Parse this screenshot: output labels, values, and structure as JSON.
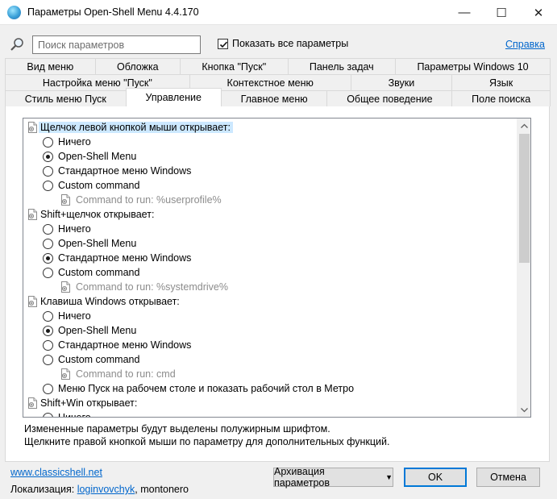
{
  "window": {
    "title": "Параметры Open-Shell Menu 4.4.170",
    "minimize_glyph": "—",
    "maximize_glyph": "☐",
    "close_glyph": "✕"
  },
  "toolbar": {
    "search_placeholder": "Поиск параметров",
    "show_all_label": "Показать все параметры",
    "show_all_checked": true,
    "help_label": "Справка"
  },
  "tabs": {
    "row1": [
      "Вид меню",
      "Обложка",
      "Кнопка \"Пуск\"",
      "Панель задач",
      "Параметры Windows 10"
    ],
    "row2": [
      "Настройка меню \"Пуск\"",
      "Контекстное меню",
      "Звуки",
      "Язык"
    ],
    "row3": [
      "Стиль меню Пуск",
      "Управление",
      "Главное меню",
      "Общее поведение",
      "Поле поиска"
    ],
    "active": "Управление"
  },
  "tree": {
    "groups": [
      {
        "label": "Щелчок левой кнопкой мыши открывает:",
        "selected": true,
        "options": [
          {
            "label": "Ничего",
            "checked": false
          },
          {
            "label": "Open-Shell Menu",
            "checked": true
          },
          {
            "label": "Стандартное меню Windows",
            "checked": false
          },
          {
            "label": "Custom command",
            "checked": false
          }
        ],
        "command": "Command to run: %userprofile%"
      },
      {
        "label": "Shift+щелчок открывает:",
        "selected": false,
        "options": [
          {
            "label": "Ничего",
            "checked": false
          },
          {
            "label": "Open-Shell Menu",
            "checked": false
          },
          {
            "label": "Стандартное меню Windows",
            "checked": true
          },
          {
            "label": "Custom command",
            "checked": false
          }
        ],
        "command": "Command to run: %systemdrive%"
      },
      {
        "label": "Клавиша Windows открывает:",
        "selected": false,
        "options": [
          {
            "label": "Ничего",
            "checked": false
          },
          {
            "label": "Open-Shell Menu",
            "checked": true
          },
          {
            "label": "Стандартное меню Windows",
            "checked": false
          },
          {
            "label": "Custom command",
            "checked": false
          }
        ],
        "command": "Command to run: cmd",
        "extra_option": {
          "label": "Меню Пуск на рабочем столе и показать рабочий стол в Метро",
          "checked": false
        }
      },
      {
        "label": "Shift+Win открывает:",
        "selected": false,
        "options": [
          {
            "label": "Ничего",
            "checked": false
          }
        ]
      }
    ]
  },
  "hints": {
    "line1": "Измененные параметры будут выделены полужирным шрифтом.",
    "line2": "Щелкните правой кнопкой мыши по параметру для дополнительных функций."
  },
  "footer": {
    "site_link": "www.classicshell.net",
    "localization_label": "Локализация:",
    "localizer_link": "loginvovchyk",
    "localizer_rest": ", montonero",
    "backup_button": "Архивация параметров",
    "ok_button": "OK",
    "cancel_button": "Отмена"
  }
}
